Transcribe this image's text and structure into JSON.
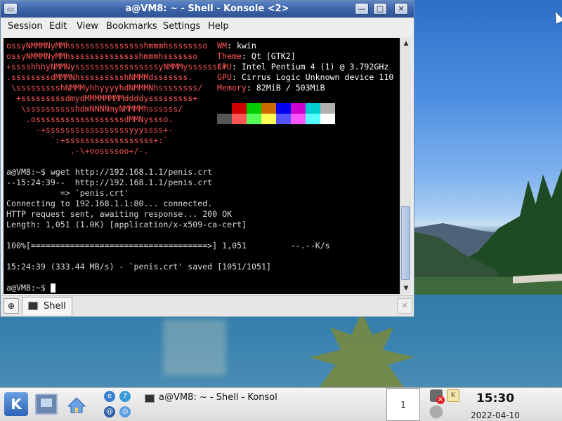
{
  "window": {
    "title": "a@VM8: ~ - Shell - Konsole <2>",
    "menu": [
      "Session",
      "Edit",
      "View",
      "Bookmarks",
      "Settings",
      "Help"
    ]
  },
  "terminal": {
    "logo": [
      "ossyNMMMNyMMh",
      "ossyNMMMNyMMh",
      "+sssshhhyNMMNy",
      ".ssssssssdMMMNh",
      " \\ssssssssshNMMMyh",
      "  +sssssssssdmydMMMMMMMMddddy",
      "   \\sssssssssshdmNNNNmyNMMMMh",
      "    .ossssssssssssssssssdMMNy",
      "      -+sssssssssssssssssyyy",
      "         `:+ssssssssssssssssss+:`",
      "             .-\\+oossssoo+/-."
    ],
    "logo_tail": [
      "ssssssssssssssshmmmhssssssso",
      "sssssssssssssshmmmhsssssso",
      "sssssssssssssssssyNMMMysssssss+",
      "ssssssssshNMMMdsssssss.",
      "hyyyyhdNMMMNhssssssss/",
      "sssssssss+",
      "ssssss/",
      "ssso.",
      "ssss+-",
      "",
      ""
    ],
    "info": [
      {
        "label": "WM",
        "value": "kwin"
      },
      {
        "label": "Theme",
        "value": "Qt [GTK2]"
      },
      {
        "label": "CPU",
        "value": "Intel Pentium 4 (1) @ 3.792GHz"
      },
      {
        "label": "GPU",
        "value": "Cirrus Logic Unknown device 110"
      },
      {
        "label": "Memory",
        "value": "82MiB / 503MiB"
      }
    ],
    "palette_top": [
      "#000000",
      "#cd0000",
      "#00cd00",
      "#cd6a00",
      "#0000ee",
      "#cd00cd",
      "#00cdcd",
      "#b0b0b0"
    ],
    "palette_bottom": [
      "#555555",
      "#ff5555",
      "#55ff55",
      "#ffff55",
      "#5555ff",
      "#ff55ff",
      "#55ffff",
      "#ffffff"
    ],
    "lines": [
      "a@VM8:~$ wget http://192.168.1.1/penis.crt",
      "--15:24:39--  http://192.168.1.1/penis.crt",
      "           => `penis.crt'",
      "Connecting to 192.168.1.1:80... connected.",
      "HTTP request sent, awaiting response... 200 OK",
      "Length: 1,051 (1.0K) [application/x-x509-ca-cert]",
      "",
      "100%[====================================>] 1,051         --.--K/s",
      "",
      "15:24:39 (333.44 MB/s) - `penis.crt' saved [1051/1051]",
      "",
      "a@VM8:~$ "
    ]
  },
  "tabs": [
    {
      "label": "Shell"
    }
  ],
  "taskbar": {
    "kmenu_label": "K",
    "task_title": "a@VM8: ~ - Shell - Konsol",
    "pager": "1",
    "klipper": "K",
    "clock_time": "15:30",
    "clock_date": "2022-04-10"
  }
}
